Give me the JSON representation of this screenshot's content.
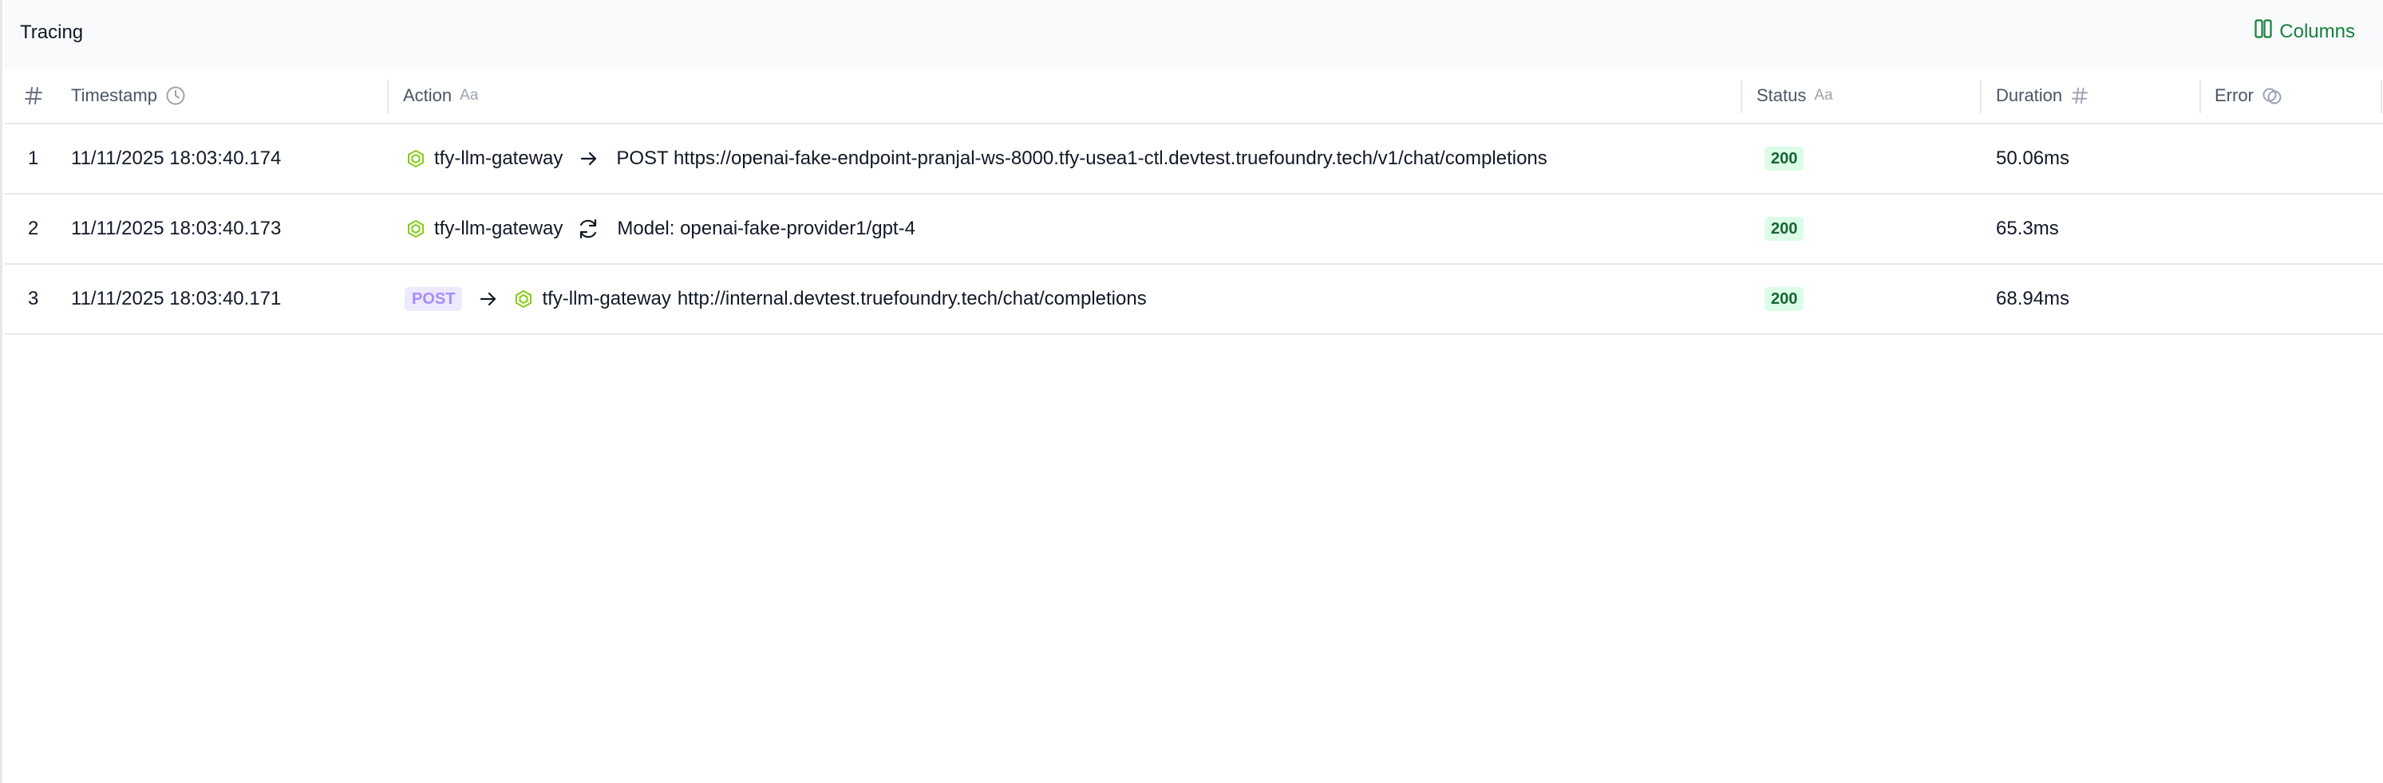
{
  "header": {
    "title": "Tracing",
    "columns_label": "Columns"
  },
  "table": {
    "columns": [
      {
        "label": "#",
        "icon": "hash-icon"
      },
      {
        "label": "Timestamp",
        "icon": "clock-icon"
      },
      {
        "label": "Action",
        "icon": "text-type-icon"
      },
      {
        "label": "Status",
        "icon": "text-type-icon"
      },
      {
        "label": "Duration",
        "icon": "hash-icon"
      },
      {
        "label": "Error",
        "icon": "error-type-icon"
      }
    ],
    "text_type_glyph": "Aa",
    "rows": [
      {
        "index": "1",
        "timestamp": "11/11/2025 18:03:40.174",
        "service": "tfy-llm-gateway",
        "action_icon": "arrow-right-icon",
        "action_text": "POST https://openai-fake-endpoint-pranjal-ws-8000.tfy-usea1-ctl.devtest.truefoundry.tech/v1/chat/completions",
        "status": "200",
        "duration": "50.06ms"
      },
      {
        "index": "2",
        "timestamp": "11/11/2025 18:03:40.173",
        "service": "tfy-llm-gateway",
        "action_icon": "refresh-icon",
        "action_text": "Model: openai-fake-provider1/gpt-4",
        "status": "200",
        "duration": "65.3ms"
      },
      {
        "index": "3",
        "timestamp": "11/11/2025 18:03:40.171",
        "method": "POST",
        "service": "tfy-llm-gateway",
        "action_icon": "arrow-right-icon",
        "action_text": "http://internal.devtest.truefoundry.tech/chat/completions",
        "status": "200",
        "duration": "68.94ms"
      }
    ]
  },
  "colors": {
    "accent": "#15803d",
    "status_ok_bg": "#dcfce7",
    "status_ok_text": "#166534",
    "method_bg": "#ede9fe",
    "method_text": "#a78bfa",
    "service_icon": "#84cc16"
  }
}
